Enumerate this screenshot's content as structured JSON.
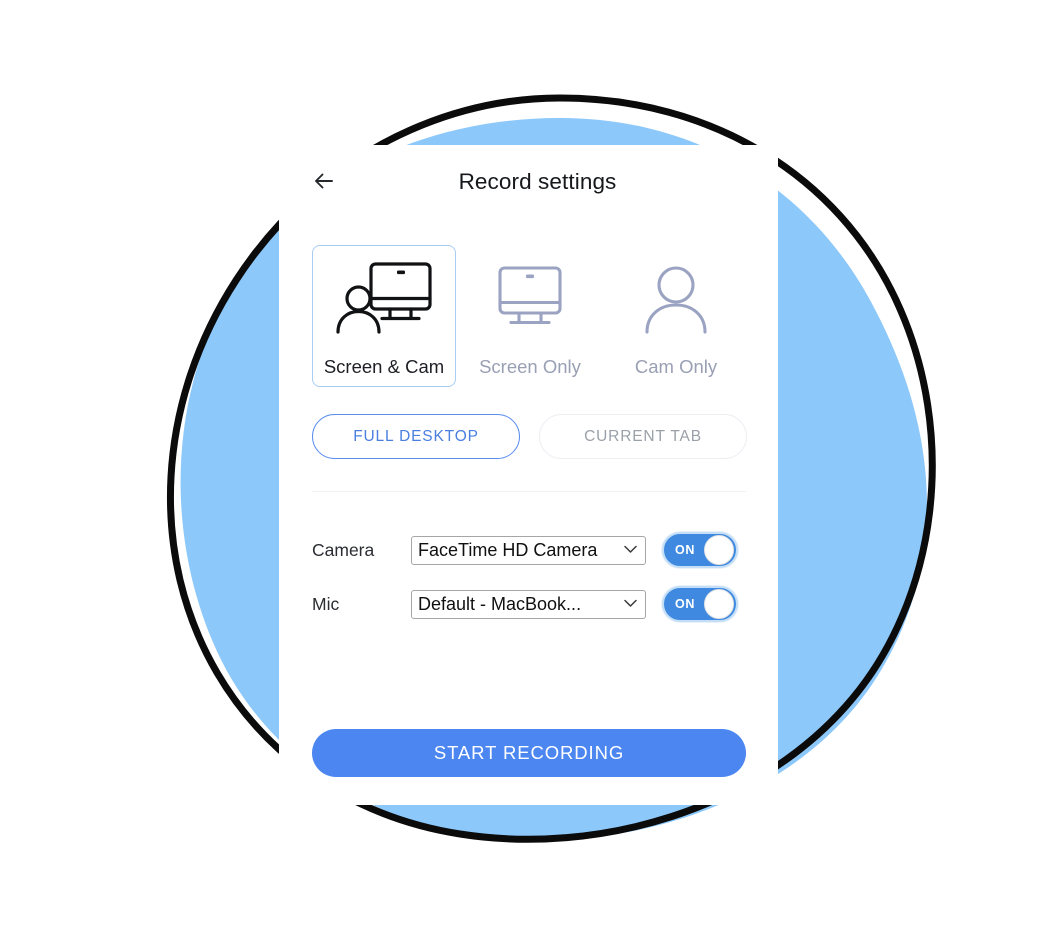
{
  "window": {
    "title": "Record settings"
  },
  "header": {
    "back_icon": "back-arrow-icon",
    "title": "Record settings"
  },
  "modes": [
    {
      "id": "screen-and-cam",
      "label": "Screen & Cam",
      "icon": "person-with-monitor-icon",
      "selected": true
    },
    {
      "id": "screen-only",
      "label": "Screen Only",
      "icon": "monitor-icon",
      "selected": false
    },
    {
      "id": "cam-only",
      "label": "Cam Only",
      "icon": "person-icon",
      "selected": false
    }
  ],
  "sources": [
    {
      "id": "full-desktop",
      "label": "FULL DESKTOP",
      "active": true
    },
    {
      "id": "current-tab",
      "label": "CURRENT TAB",
      "active": false
    }
  ],
  "devices": [
    {
      "id": "camera",
      "label": "Camera",
      "value": "FaceTime HD Camera",
      "options": [
        "FaceTime HD Camera"
      ],
      "toggle": {
        "label": "ON",
        "on": true
      }
    },
    {
      "id": "mic",
      "label": "Mic",
      "value": "Default - MacBook...",
      "options": [
        "Default - MacBook..."
      ],
      "toggle": {
        "label": "ON",
        "on": true
      }
    }
  ],
  "actions": {
    "start_recording": "START RECORDING"
  },
  "colors": {
    "accent_blue": "#4c86f0",
    "pill_active_border": "#5b8def",
    "pill_active_text": "#4a7fe0",
    "muted_text": "#9aa0b4",
    "toggle_on": "#3f8ae0",
    "blob_blue": "#8cc8fa",
    "outline_black": "#000000",
    "card_bg": "#ffffff"
  },
  "decor": {
    "blob": "blue-blob-shape",
    "ring": "black-circle-outline"
  }
}
